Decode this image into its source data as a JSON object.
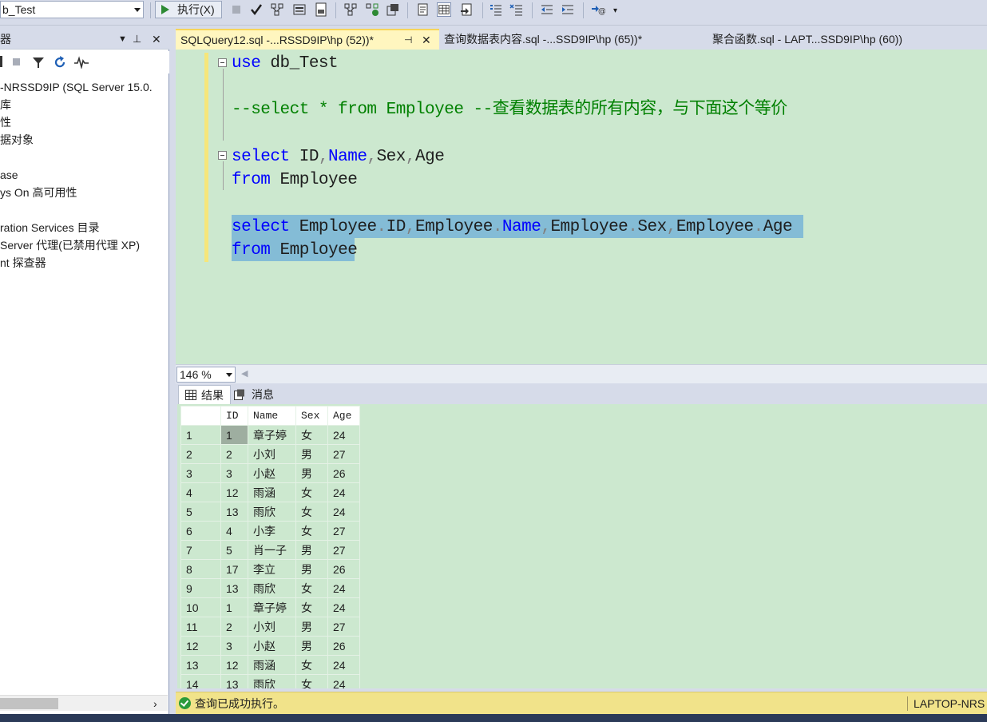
{
  "toolbar": {
    "database": "b_Test",
    "execute_label": "执行(X)"
  },
  "object_explorer": {
    "title": "器",
    "items": [
      "-NRSSD9IP (SQL Server 15.0.",
      "库",
      "性",
      "据对象",
      "",
      "ase",
      "ys On 高可用性",
      "",
      "ration Services 目录",
      "Server 代理(已禁用代理 XP)",
      "nt 探查器"
    ]
  },
  "tabs": [
    {
      "label": "SQLQuery12.sql -...RSSD9IP\\hp (52))*"
    },
    {
      "label": "查询数据表内容.sql -...SSD9IP\\hp (65))*"
    },
    {
      "label": "聚合函数.sql - LAPT...SSD9IP\\hp (60))"
    }
  ],
  "editor": {
    "line1_kw": "use",
    "line1_rest": " db_Test",
    "line2_comment": "--select * from Employee --查看数据表的所有内容，与下面这个等价",
    "line3_kw": "select",
    "line3_a": " ID",
    "line3_comma1": ",",
    "line3_name": "Name",
    "line3_comma2": ",",
    "line3_b": "Sex",
    "line3_comma3": ",",
    "line3_c": "Age",
    "line4_kw": "from",
    "line4_rest": " Employee",
    "line5_kw": "select",
    "line5_t1": " Employee",
    "line5_d1": ".",
    "line5_c1": "ID",
    "line5_cm1": ",",
    "line5_t2": "Employee",
    "line5_d2": ".",
    "line5_c2": "Name",
    "line5_cm2": ",",
    "line5_t3": "Employee",
    "line5_d3": ".",
    "line5_c3": "Sex",
    "line5_cm3": ",",
    "line5_t4": "Employee",
    "line5_d4": ".",
    "line5_c4": "Age",
    "line6_kw": "from",
    "line6_rest": " Employee"
  },
  "zoom": "146 %",
  "result_tabs": {
    "results": "结果",
    "messages": "消息"
  },
  "grid": {
    "columns": [
      "ID",
      "Name",
      "Sex",
      "Age"
    ],
    "rows": [
      [
        "1",
        "1",
        "章子婷",
        "女",
        "24"
      ],
      [
        "2",
        "2",
        "小刘",
        "男",
        "27"
      ],
      [
        "3",
        "3",
        "小赵",
        "男",
        "26"
      ],
      [
        "4",
        "12",
        "雨涵",
        "女",
        "24"
      ],
      [
        "5",
        "13",
        "雨欣",
        "女",
        "24"
      ],
      [
        "6",
        "4",
        "小李",
        "女",
        "27"
      ],
      [
        "7",
        "5",
        "肖一子",
        "男",
        "27"
      ],
      [
        "8",
        "17",
        "李立",
        "男",
        "26"
      ],
      [
        "9",
        "13",
        "雨欣",
        "女",
        "24"
      ],
      [
        "10",
        "1",
        "章子婷",
        "女",
        "24"
      ],
      [
        "11",
        "2",
        "小刘",
        "男",
        "27"
      ],
      [
        "12",
        "3",
        "小赵",
        "男",
        "26"
      ],
      [
        "13",
        "12",
        "雨涵",
        "女",
        "24"
      ],
      [
        "14",
        "13",
        "雨欣",
        "女",
        "24"
      ]
    ]
  },
  "status": {
    "message": "查询已成功执行。",
    "server": "LAPTOP-NRS"
  }
}
